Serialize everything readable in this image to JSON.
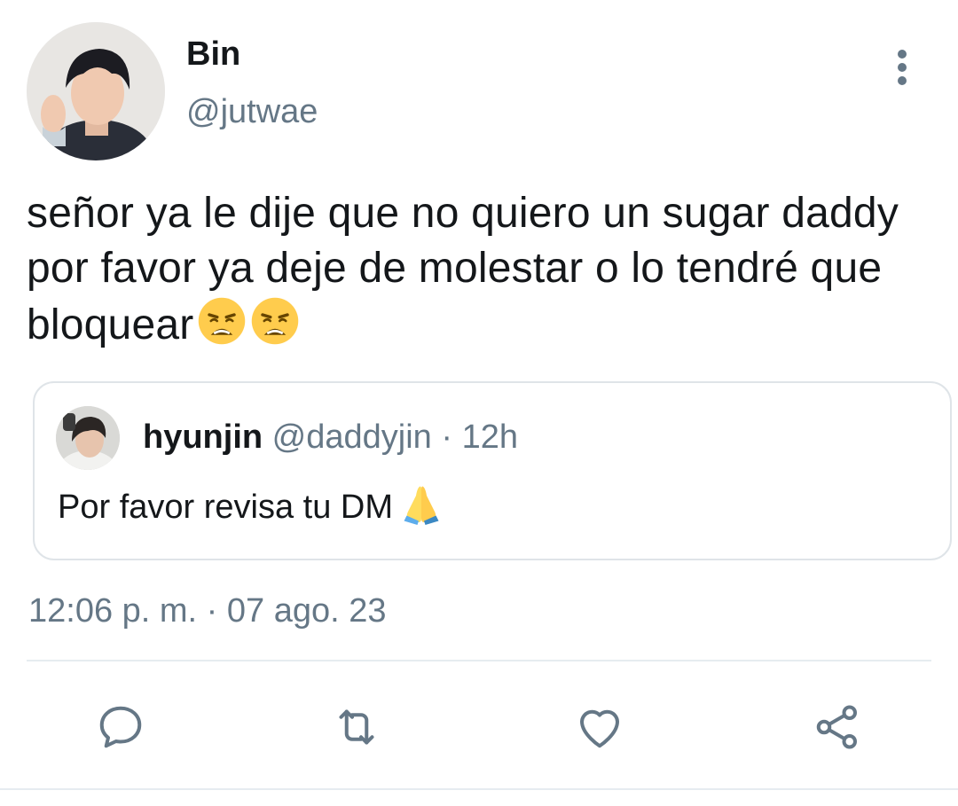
{
  "author": {
    "display_name": "Bin",
    "handle": "@jutwae"
  },
  "tweet": {
    "text": "señor ya le dije que no quiero un sugar daddy por favor ya deje de molestar o lo tendré que bloquear",
    "emojis": [
      "weary-face-emoji",
      "weary-face-emoji"
    ]
  },
  "quote": {
    "display_name": "hyunjin",
    "handle": "@daddyjin",
    "separator": "·",
    "time": "12h",
    "text": "Por favor revisa tu DM",
    "emoji": "folded-hands-emoji"
  },
  "meta": {
    "timestamp": "12:06 p. m. · 07 ago. 23"
  },
  "actions": [
    "reply-icon",
    "retweet-icon",
    "like-icon",
    "share-icon"
  ],
  "colors": {
    "text_primary": "#14171a",
    "text_secondary": "#657786",
    "border": "#dfe4e8"
  }
}
